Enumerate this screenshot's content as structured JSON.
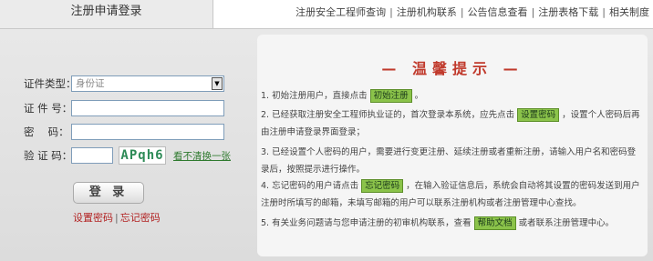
{
  "tabs": {
    "active_label": "注册申请登录"
  },
  "top_links": [
    "注册安全工程师查询",
    "注册机构联系",
    "公告信息查看",
    "注册表格下载",
    "相关制度"
  ],
  "login": {
    "cert_type_label": "证件类型：",
    "cert_type_value": "身份证",
    "cert_no_label": "证 件 号：",
    "password_label": "密　 码：",
    "captcha_label": "验 证 码：",
    "captcha_text": "APqh6",
    "refresh_label": "看不清换一张",
    "login_button": "登 录",
    "set_password_link": "设置密码",
    "forgot_password_link": "忘记密码"
  },
  "notice": {
    "title": "— 温馨提示 —",
    "steps": [
      {
        "before": "1. 初始注册用户，直接点击",
        "button": "初始注册",
        "after": "。"
      },
      {
        "before": "2. 已经获取注册安全工程师执业证的，首次登录本系统，应先点击",
        "button": "设置密码",
        "after": "，设置个人密码后再由注册申请登录界面登录；"
      },
      {
        "before": "3. 已经设置个人密码的用户，需要进行变更注册、延续注册或者重新注册，请输入用户名和密码登录后，按照提示进行操作。",
        "button": "",
        "after": ""
      },
      {
        "before": "4. 忘记密码的用户请点击",
        "button": "忘记密码",
        "after": "，在输入验证信息后，系统会自动将其设置的密码发送到用户注册时所填写的邮箱，未填写邮箱的用户可以联系注册机构或者注册管理中心查找。"
      },
      {
        "before": "5. 有关业务问题请与您申请注册的初审机构联系，查看",
        "button": "帮助文档",
        "after": "或者联系注册管理中心。"
      }
    ]
  }
}
